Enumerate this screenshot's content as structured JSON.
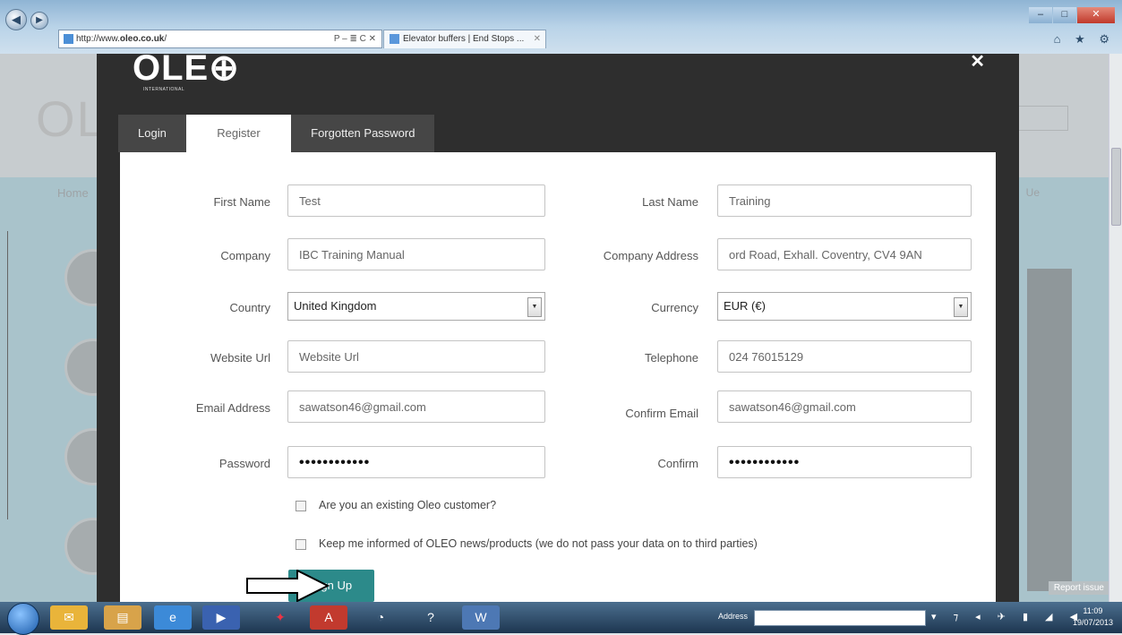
{
  "browser": {
    "url_prefix": "http://www.",
    "url_host": "oleo.co.uk",
    "url_suffix": "/",
    "address_controls": "P – ≣ C ✕",
    "tab_title": "Elevator buffers | End Stops ...",
    "tab_close": "✕",
    "window_min": "–",
    "window_max": "□",
    "window_close": "✕",
    "toolbar_icons": "⌂ ★ ⚙"
  },
  "modal": {
    "logo_text": "OLE⊕",
    "logo_sub": "INTERNATIONAL",
    "close": "✕",
    "tabs": [
      {
        "label": "Login"
      },
      {
        "label": "Register"
      },
      {
        "label": "Forgotten Password"
      }
    ]
  },
  "form": {
    "first_name": {
      "label": "First Name",
      "value": "Test"
    },
    "last_name": {
      "label": "Last Name",
      "value": "Training"
    },
    "company": {
      "label": "Company",
      "value": "IBC Training Manual"
    },
    "company_address": {
      "label": "Company Address",
      "value": "ord Road, Exhall. Coventry, CV4 9AN"
    },
    "country": {
      "label": "Country",
      "value": "United Kingdom"
    },
    "currency": {
      "label": "Currency",
      "value": "EUR (€)"
    },
    "website": {
      "label": "Website Url",
      "value": "Website Url"
    },
    "telephone": {
      "label": "Telephone",
      "value": "024 76015129"
    },
    "email": {
      "label": "Email Address",
      "value": "sawatson46@gmail.com"
    },
    "confirm_email": {
      "label": "Confirm Email",
      "value": "sawatson46@gmail.com"
    },
    "password": {
      "label": "Password",
      "value": "••••••••••••"
    },
    "confirm_password": {
      "label": "Confirm",
      "value": "••••••••••••"
    },
    "existing_customer": "Are you an existing Oleo customer?",
    "keep_informed": "Keep me informed of OLEO news/products (we do not pass your data on to third parties)",
    "submit": "Sign Up",
    "select_arrow": "▼"
  },
  "background": {
    "logo": "OL",
    "home": "Home",
    "right_link": "Ue",
    "report_issue": "Report issue"
  },
  "taskbar": {
    "address_label": "Address",
    "tray_icons": "▾ ⁊ ◂ ✈ ▮ ◢ ◀",
    "time": "11:09",
    "date": "19/07/2013"
  }
}
